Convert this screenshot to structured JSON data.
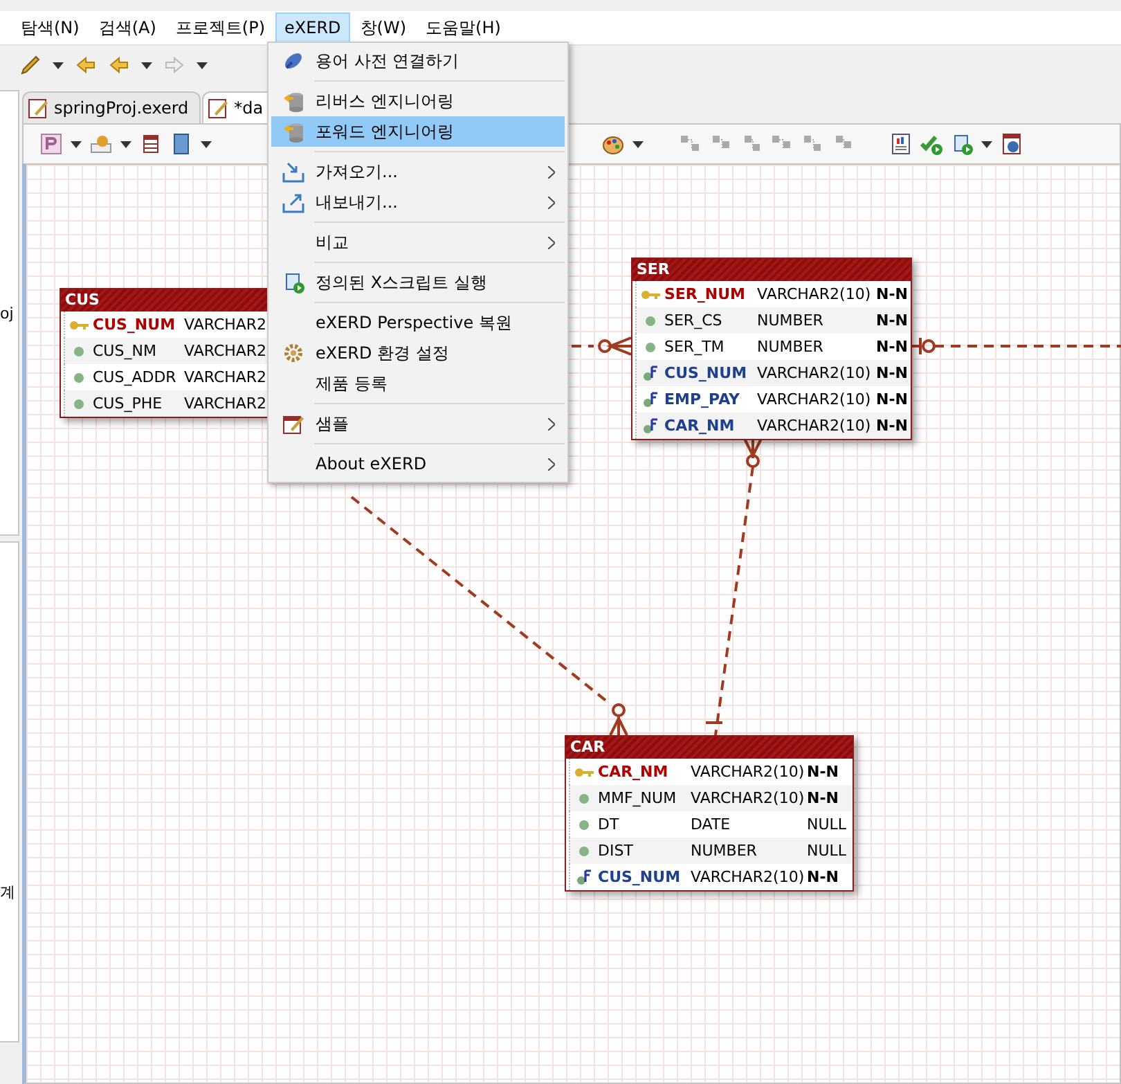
{
  "menubar": [
    {
      "label": "탐색(N)",
      "open": false
    },
    {
      "label": "검색(A)",
      "open": false
    },
    {
      "label": "프로젝트(P)",
      "open": false
    },
    {
      "label": "eXERD",
      "open": true
    },
    {
      "label": "창(W)",
      "open": false
    },
    {
      "label": "도움말(H)",
      "open": false
    }
  ],
  "left_panel": {
    "fragments": [
      "oj",
      "계"
    ]
  },
  "tabs": [
    {
      "label": "springProj.exerd",
      "selected": false
    },
    {
      "label": "*da",
      "selected": true
    }
  ],
  "entities": [
    {
      "name": "CUS",
      "columns": [
        {
          "kind": "pk",
          "name": "CUS_NUM",
          "type": "VARCHAR2"
        },
        {
          "kind": "attr",
          "name": "CUS_NM",
          "type": "VARCHAR2"
        },
        {
          "kind": "attr",
          "name": "CUS_ADDR",
          "type": "VARCHAR2"
        },
        {
          "kind": "attr",
          "name": "CUS_PHE",
          "type": "VARCHAR2"
        }
      ]
    },
    {
      "name": "SER",
      "columns": [
        {
          "kind": "pk",
          "name": "SER_NUM",
          "type": "VARCHAR2(10)",
          "nullity": "N-N"
        },
        {
          "kind": "attr",
          "name": "SER_CS",
          "type": "NUMBER",
          "nullity": "N-N"
        },
        {
          "kind": "attr",
          "name": "SER_TM",
          "type": "NUMBER",
          "nullity": "N-N"
        },
        {
          "kind": "fk",
          "name": "CUS_NUM",
          "type": "VARCHAR2(10)",
          "nullity": "N-N"
        },
        {
          "kind": "fk",
          "name": "EMP_PAY",
          "type": "VARCHAR2(10)",
          "nullity": "N-N"
        },
        {
          "kind": "fk",
          "name": "CAR_NM",
          "type": "VARCHAR2(10)",
          "nullity": "N-N"
        }
      ]
    },
    {
      "name": "CAR",
      "columns": [
        {
          "kind": "pk",
          "name": "CAR_NM",
          "type": "VARCHAR2(10)",
          "nullity": "N-N"
        },
        {
          "kind": "attr",
          "name": "MMF_NUM",
          "type": "VARCHAR2(10)",
          "nullity": "N-N"
        },
        {
          "kind": "attr",
          "name": "DT",
          "type": "DATE",
          "nullity": "NULL"
        },
        {
          "kind": "attr",
          "name": "DIST",
          "type": "NUMBER",
          "nullity": "NULL"
        },
        {
          "kind": "fk",
          "name": "CUS_NUM",
          "type": "VARCHAR2(10)",
          "nullity": "N-N"
        }
      ]
    }
  ],
  "menu": {
    "items": [
      {
        "kind": "item",
        "label": "용어 사전 연결하기",
        "selected": false,
        "submenu": false
      },
      {
        "kind": "separator"
      },
      {
        "kind": "item",
        "label": "리버스 엔지니어링",
        "selected": false,
        "submenu": false
      },
      {
        "kind": "item",
        "label": "포워드 엔지니어링",
        "selected": true,
        "submenu": false
      },
      {
        "kind": "separator"
      },
      {
        "kind": "item",
        "label": "가져오기...",
        "selected": false,
        "submenu": true
      },
      {
        "kind": "item",
        "label": "내보내기...",
        "selected": false,
        "submenu": true
      },
      {
        "kind": "separator"
      },
      {
        "kind": "item",
        "label": "비교",
        "selected": false,
        "submenu": true
      },
      {
        "kind": "separator"
      },
      {
        "kind": "item",
        "label": "정의된 X스크립트 실행",
        "selected": false,
        "submenu": false
      },
      {
        "kind": "separator"
      },
      {
        "kind": "item",
        "label": "eXERD Perspective 복원",
        "selected": false,
        "submenu": false
      },
      {
        "kind": "item",
        "label": "eXERD 환경 설정",
        "selected": false,
        "submenu": false
      },
      {
        "kind": "item",
        "label": "제품 등록",
        "selected": false,
        "submenu": false
      },
      {
        "kind": "separator"
      },
      {
        "kind": "item",
        "label": "샘플",
        "selected": false,
        "submenu": true
      },
      {
        "kind": "separator"
      },
      {
        "kind": "item",
        "label": "About eXERD",
        "selected": false,
        "submenu": true
      }
    ]
  }
}
